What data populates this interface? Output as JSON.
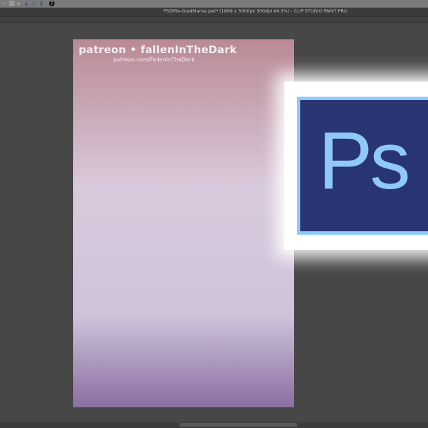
{
  "toolbar": {
    "icons": [
      "pen-tool-icon",
      "layer-icon",
      "record-icon",
      "ruler-icon",
      "select-icon",
      "eyedropper-icon",
      "help-icon"
    ],
    "help_label": "?"
  },
  "window": {
    "title": "PSDFile-GoatMama.psd* (1809 x 3000px 300dpi 40.3%)  - CLIP STUDIO PAINT PRO"
  },
  "canvas": {
    "watermark_line1": "patreon • fallenInTheDark",
    "watermark_line2": "patreon.com/FallenInTheDark"
  },
  "overlay": {
    "logo_text": "Ps",
    "colors": {
      "logo_bg": "#283572",
      "logo_fg": "#8fc9f7"
    }
  }
}
